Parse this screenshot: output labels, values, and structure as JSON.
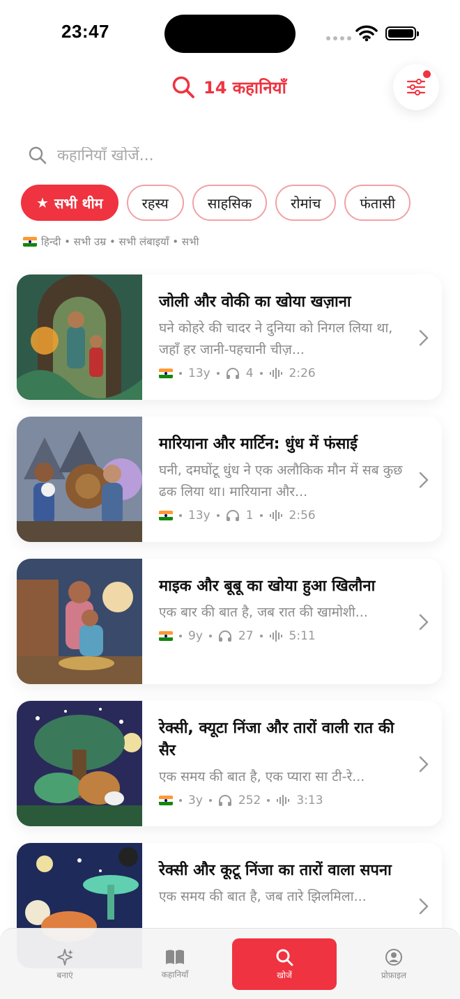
{
  "status": {
    "time": "23:47"
  },
  "header": {
    "title": "14 कहानियाँ"
  },
  "search": {
    "placeholder": "कहानियाँ खोजें..."
  },
  "chips": [
    {
      "label": "सभी थीम",
      "active": true
    },
    {
      "label": "रहस्य"
    },
    {
      "label": "साहसिक"
    },
    {
      "label": "रोमांच"
    },
    {
      "label": "फंतासी"
    }
  ],
  "filters_summary": "हिन्दी • सभी उम्र • सभी लंबाइयाँ • सभी",
  "stories": [
    {
      "title": "जोली और वोकी का खोया खज़ाना",
      "description": "घने कोहरे की चादर ने दुनिया को निगल लिया था, जहाँ हर जानी-पहचानी चीज़...",
      "age": "13y",
      "listens": "4",
      "duration": "2:26"
    },
    {
      "title": "मारियाना और मार्टिन: धुंध में फंसाई",
      "description": "घनी, दमघोंटू धुंध ने एक अलौकिक मौन में सब कुछ ढक लिया था। मारियाना और...",
      "age": "13y",
      "listens": "1",
      "duration": "2:56"
    },
    {
      "title": "माइक और बूबू का खोया हुआ खिलौना",
      "description": "एक बार की बात है, जब रात की खामोशी...",
      "age": "9y",
      "listens": "27",
      "duration": "5:11"
    },
    {
      "title": "रेक्सी, क्यूटा निंजा और तारों वाली रात की सैर",
      "description": "एक समय की बात है, एक प्यारा सा टी-रे...",
      "age": "3y",
      "listens": "252",
      "duration": "3:13"
    },
    {
      "title": "रेक्सी और कूटू निंजा का तारों वाला सपना",
      "description": "एक समय की बात है, जब तारे झिलमिला...",
      "age": "",
      "listens": "",
      "duration": ""
    }
  ],
  "tabs": [
    {
      "label": "बनाएं",
      "icon": "sparkles-icon"
    },
    {
      "label": "कहानियाँ",
      "icon": "book-icon"
    },
    {
      "label": "खोजें",
      "icon": "search-icon",
      "active": true
    },
    {
      "label": "प्रोफ़ाइल",
      "icon": "profile-icon"
    }
  ],
  "colors": {
    "accent": "#ef3340",
    "chip_border": "#f1a1a6"
  }
}
